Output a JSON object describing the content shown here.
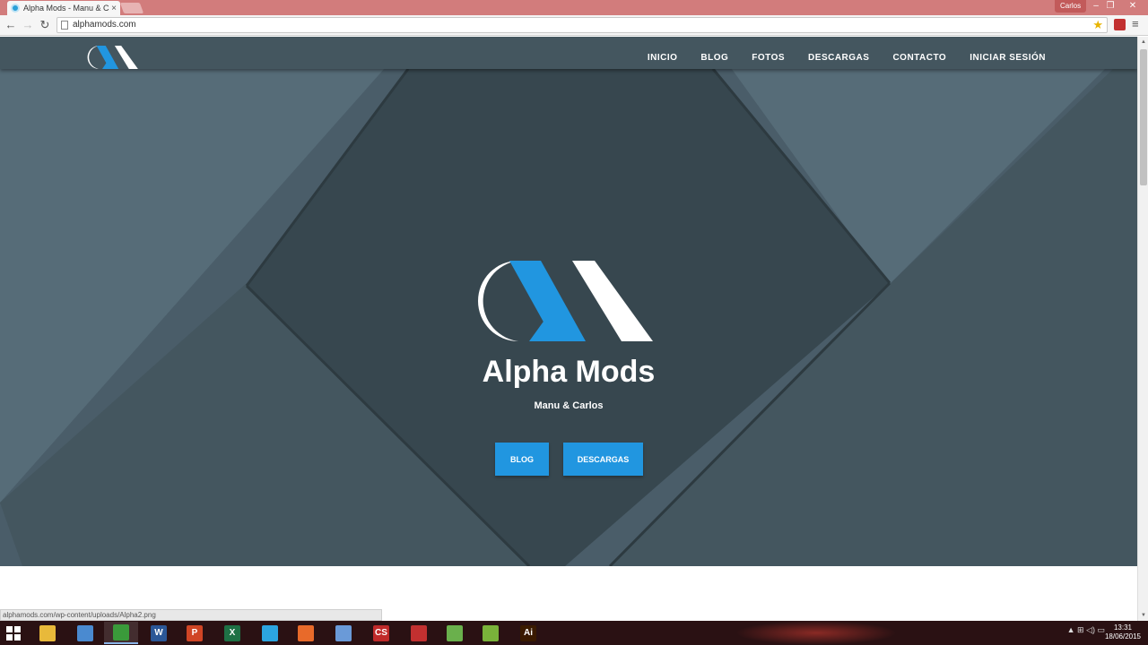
{
  "browser": {
    "tab_title": "Alpha Mods - Manu & Ca",
    "tab_close": "×",
    "user_name": "Carlos",
    "url": "alphamods.com",
    "status_url": "alphamods.com/wp-content/uploads/Alpha2.png",
    "icons": {
      "back": "←",
      "forward": "→",
      "reload": "↻",
      "star": "★",
      "menu": "≡",
      "minimize": "–",
      "restore": "❐",
      "close": "✕"
    }
  },
  "site": {
    "nav": [
      "INICIO",
      "BLOG",
      "FOTOS",
      "DESCARGAS",
      "CONTACTO",
      "INICIAR SESIÓN"
    ],
    "title": "Alpha Mods",
    "subtitle": "Manu & Carlos",
    "buttons": {
      "blog": "BLOG",
      "downloads": "DESCARGAS"
    },
    "colors": {
      "accent": "#2196e0",
      "hero_dark": "#37474f",
      "hero_mid": "#4a5d69",
      "hero_light": "#566c78"
    }
  },
  "taskbar": {
    "apps": [
      {
        "name": "file-explorer-icon",
        "label": "",
        "color": "#e8b93a"
      },
      {
        "name": "control-panel-icon",
        "label": "",
        "color": "#4a8ad0"
      },
      {
        "name": "chrome-icon",
        "label": "",
        "color": "#3a9a3a",
        "active": true
      },
      {
        "name": "word-icon",
        "label": "W",
        "color": "#2b5797"
      },
      {
        "name": "powerpoint-icon",
        "label": "P",
        "color": "#d04525"
      },
      {
        "name": "excel-icon",
        "label": "X",
        "color": "#1e7145"
      },
      {
        "name": "telegram-icon",
        "label": "",
        "color": "#2ca5e0"
      },
      {
        "name": "app-icon-orange",
        "label": "",
        "color": "#e86a2a"
      },
      {
        "name": "virtualbox-icon",
        "label": "",
        "color": "#6a9ad8"
      },
      {
        "name": "eagle-icon",
        "label": "CS",
        "color": "#c02a2a"
      },
      {
        "name": "sketchup-icon",
        "label": "",
        "color": "#c23030"
      },
      {
        "name": "android-studio-icon",
        "label": "",
        "color": "#6ab04c"
      },
      {
        "name": "app-icon-green",
        "label": "",
        "color": "#7ab23a"
      },
      {
        "name": "illustrator-icon",
        "label": "Ai",
        "color": "#3a1a00"
      }
    ],
    "tray_icons": "▲ ⊞ ◁) ▭",
    "time": "13:31",
    "date": "18/06/2015"
  }
}
